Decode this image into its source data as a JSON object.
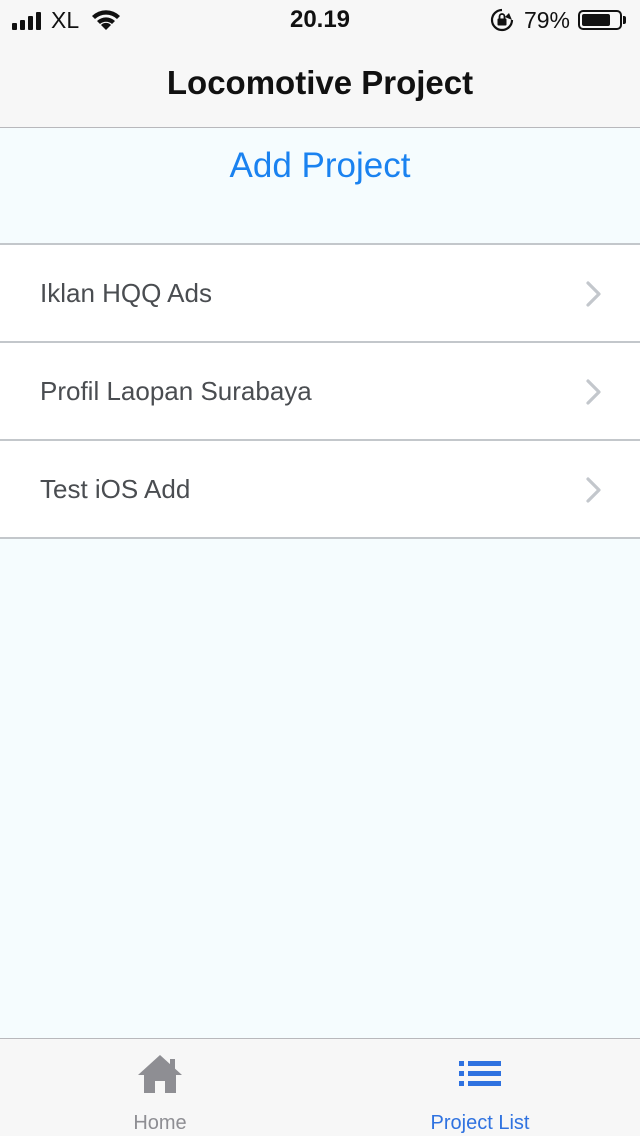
{
  "status_bar": {
    "carrier": "XL",
    "time": "20.19",
    "battery_percent": "79%",
    "battery_level": 0.79,
    "icons": [
      "signal-icon",
      "wifi-icon",
      "rotation-lock-icon",
      "battery-icon"
    ]
  },
  "nav": {
    "title": "Locomotive Project"
  },
  "add_project": {
    "label": "Add Project"
  },
  "projects": [
    {
      "label": "Iklan HQQ Ads"
    },
    {
      "label": "Profil Laopan Surabaya"
    },
    {
      "label": "Test iOS Add"
    }
  ],
  "tab_bar": {
    "items": [
      {
        "label": "Home",
        "icon": "home-icon",
        "active": false
      },
      {
        "label": "Project List",
        "icon": "list-icon",
        "active": true
      }
    ]
  },
  "colors": {
    "accent": "#1a82f0",
    "tab_active": "#2f72e0",
    "tab_inactive": "#8e8e93",
    "background": "#f5fcfe"
  }
}
